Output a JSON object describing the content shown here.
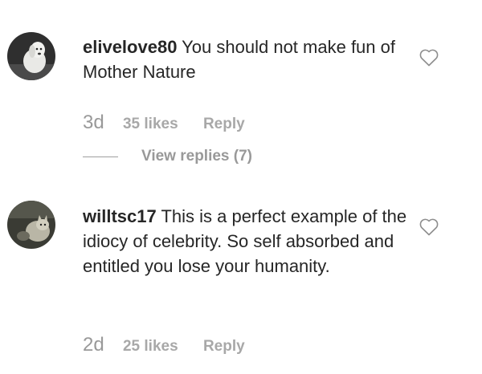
{
  "comments": [
    {
      "username": "elivelove80",
      "text": "You should not make fun of Mother Nature",
      "time": "3d",
      "likes": "35 likes",
      "reply_label": "Reply",
      "view_replies": "View replies (7)",
      "avatar_icon": "dog-avatar",
      "like_icon": "heart-outline"
    },
    {
      "username": "willtsc17",
      "text": "This is a perfect example of the idiocy of celebrity. So self absorbed and entitled you lose your humanity.",
      "time": "2d",
      "likes": "25 likes",
      "reply_label": "Reply",
      "avatar_icon": "cat-avatar",
      "like_icon": "heart-outline"
    }
  ],
  "colors": {
    "text": "#262626",
    "meta": "#999999"
  }
}
